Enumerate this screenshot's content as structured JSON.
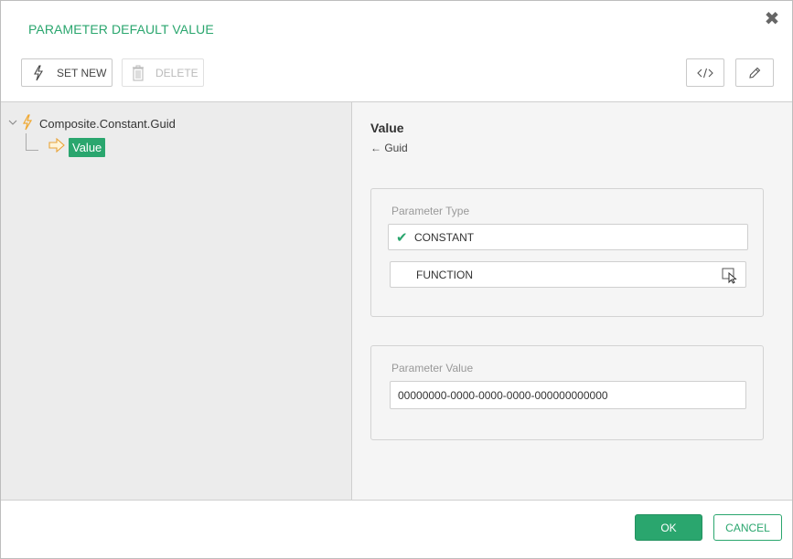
{
  "dialog": {
    "title": "PARAMETER DEFAULT VALUE",
    "close_icon": "close-icon"
  },
  "toolbar": {
    "set_new_label": "SET NEW",
    "delete_label": "DELETE",
    "code_icon": "code-icon",
    "edit_icon": "pencil-icon"
  },
  "tree": {
    "root_label": "Composite.Constant.Guid",
    "child_label": "Value"
  },
  "detail": {
    "title": "Value",
    "subtitle": "← Guid",
    "parameter_type": {
      "label": "Parameter Type",
      "options": [
        {
          "label": "CONSTANT",
          "selected": true
        },
        {
          "label": "FUNCTION",
          "selected": false
        }
      ]
    },
    "parameter_value": {
      "label": "Parameter Value",
      "value": "00000000-0000-0000-0000-000000000000"
    }
  },
  "footer": {
    "ok_label": "OK",
    "cancel_label": "CANCEL"
  },
  "colors": {
    "accent": "#2aa66e",
    "bolt": "#f0a830"
  }
}
